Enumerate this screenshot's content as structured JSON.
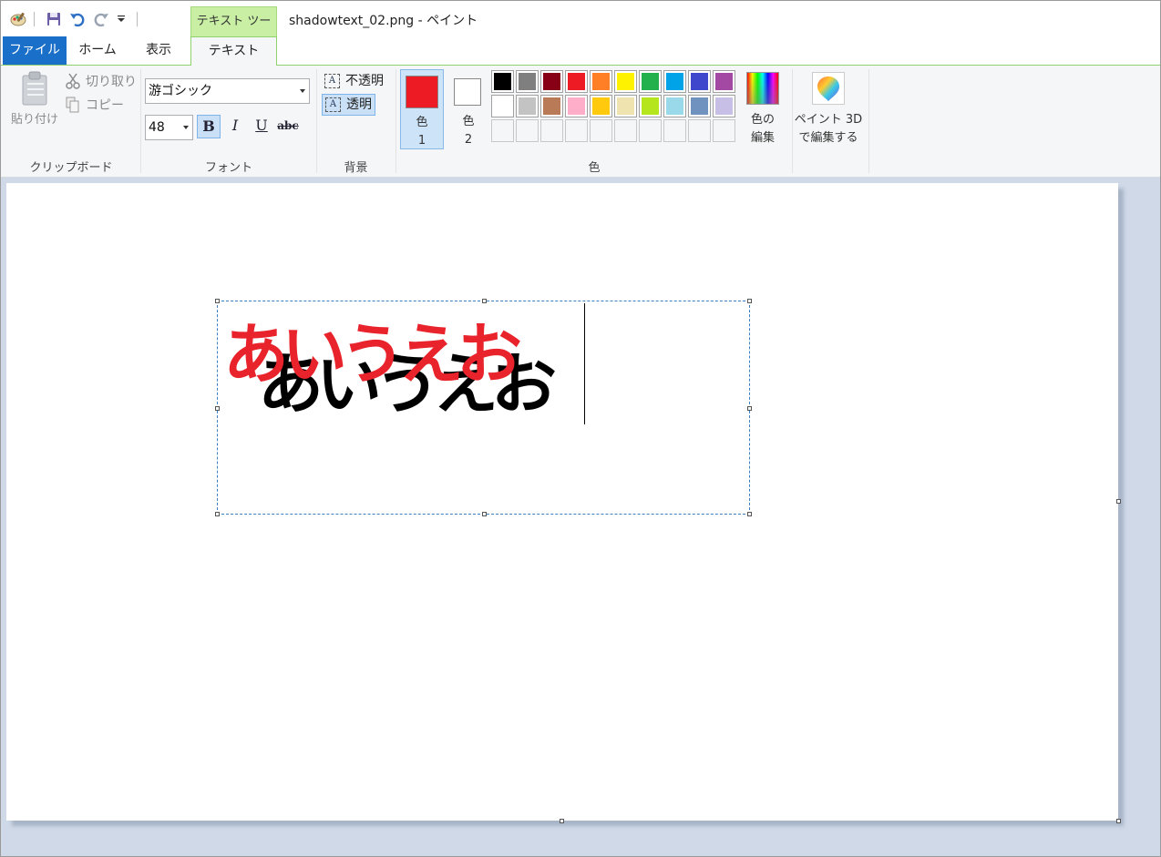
{
  "window": {
    "title": "shadowtext_02.png - ペイント",
    "context_tab": "テキスト ツール"
  },
  "quick_access": {
    "icons": [
      "paint-app-icon",
      "save-icon",
      "undo-icon",
      "redo-icon",
      "customize-dropdown-icon"
    ]
  },
  "tabs": [
    {
      "label": "ファイル",
      "active": false
    },
    {
      "label": "ホーム",
      "active": false
    },
    {
      "label": "表示",
      "active": false
    },
    {
      "label": "テキスト",
      "active": true
    }
  ],
  "clipboard": {
    "paste_label": "貼り付け",
    "cut_label": "切り取り",
    "copy_label": "コピー",
    "group_label": "クリップボード"
  },
  "font": {
    "family": "游ゴシック",
    "size": "48",
    "bold_label": "B",
    "italic_label": "I",
    "underline_label": "U",
    "strike_label": "abc",
    "bold_active": true,
    "group_label": "フォント"
  },
  "background": {
    "opaque_label": "不透明",
    "transparent_label": "透明",
    "selected": "transparent",
    "group_label": "背景"
  },
  "colors": {
    "color1_label_line1": "色",
    "color1_label_line2": "1",
    "color1_value": "#ed1c24",
    "color2_label_line1": "色",
    "color2_label_line2": "2",
    "color2_value": "#ffffff",
    "palette": [
      "#000000",
      "#7f7f7f",
      "#880015",
      "#ed1c24",
      "#ff7f27",
      "#fff200",
      "#22b14c",
      "#00a2e8",
      "#3f48cc",
      "#a349a4",
      "#ffffff",
      "#c3c3c3",
      "#b97a57",
      "#ffaec9",
      "#ffc90e",
      "#efe4b0",
      "#b5e61d",
      "#99d9ea",
      "#7092be",
      "#c8bfe7"
    ],
    "edit_colors_line1": "色の",
    "edit_colors_line2": "編集",
    "group_label": "色"
  },
  "paint3d": {
    "label_line1": "ペイント 3D",
    "label_line2": "で編集する"
  },
  "canvas_text": {
    "shadow": "あいうえお",
    "shadow_color": "#000000",
    "foreground": "あいうえお",
    "foreground_color": "#e8232c"
  }
}
